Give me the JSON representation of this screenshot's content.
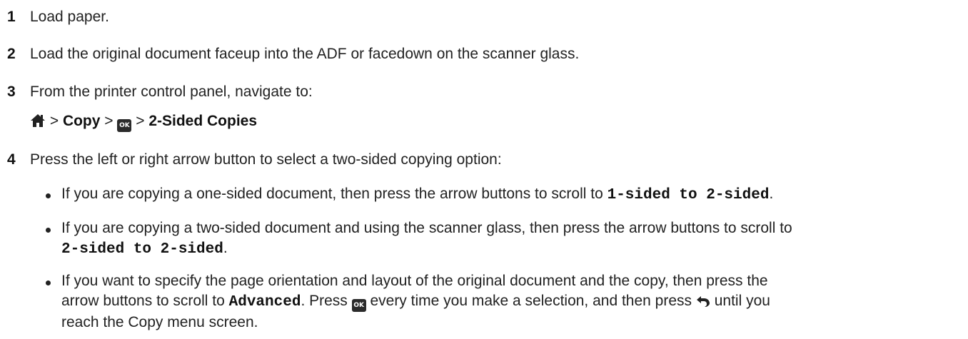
{
  "steps": [
    {
      "num": "1",
      "text": "Load paper."
    },
    {
      "num": "2",
      "text": "Load the original document faceup into the ADF or facedown on the scanner glass."
    },
    {
      "num": "3",
      "text": "From the printer control panel, navigate to:"
    },
    {
      "num": "4",
      "text": "Press the left or right arrow button to select a two-sided copying option:"
    }
  ],
  "navigation_path": {
    "separator": " > ",
    "copy_label": "Copy",
    "ok_icon_text": "OK",
    "final_label": "2-Sided Copies"
  },
  "bullets": [
    {
      "before": "If you are copying a one-sided document, then press the arrow buttons to scroll to ",
      "code": "1-sided to 2-sided",
      "after": "."
    },
    {
      "before": "If you are copying a two-sided document and using the scanner glass, then press the arrow buttons to scroll to",
      "code": "2-sided to 2-sided",
      "after": "."
    },
    {
      "line1": "If you want to specify the page orientation and layout of the original document and the copy, then press the",
      "line2_before": "arrow buttons to scroll to ",
      "code": "Advanced",
      "line2_mid": ". Press ",
      "line2_mid2": " every time you make a selection, and then press ",
      "line2_after": " until you",
      "line3": "reach the Copy menu screen."
    }
  ],
  "icons": {
    "home": "home-icon",
    "ok": "ok-button-icon",
    "back": "back-arrow-icon"
  }
}
